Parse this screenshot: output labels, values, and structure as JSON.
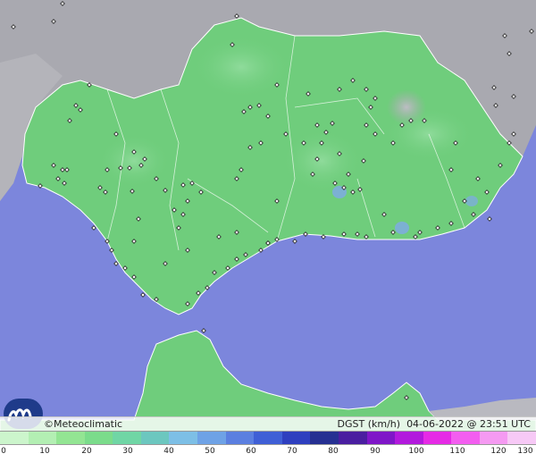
{
  "map": {
    "brand": "©Meteoclimatic",
    "variable": "DGST (km/h)",
    "timestamp": "04-06-2022 @ 23:51 UTC"
  },
  "legend": {
    "ticks": [
      "0",
      "10",
      "20",
      "30",
      "40",
      "50",
      "60",
      "70",
      "80",
      "90",
      "100",
      "110",
      "120",
      "130"
    ],
    "colors": [
      "#ccf5cc",
      "#b3efb3",
      "#93e593",
      "#7bdc8b",
      "#70d6a5",
      "#6cc7bf",
      "#7dbfe6",
      "#6ea2e6",
      "#5b7fe0",
      "#3f5fd6",
      "#2e3fbf",
      "#263092",
      "#4a1ea0",
      "#7f16c8",
      "#b219dd",
      "#e62ae6",
      "#f35ef0",
      "#f59af2",
      "#f7c9f6"
    ]
  },
  "colors": {
    "sea": "#7c86dc",
    "land": "#6fcd7c",
    "outside_land": "#a8a8ae",
    "border": "#ffffff"
  },
  "stations_count_hint": "many"
}
